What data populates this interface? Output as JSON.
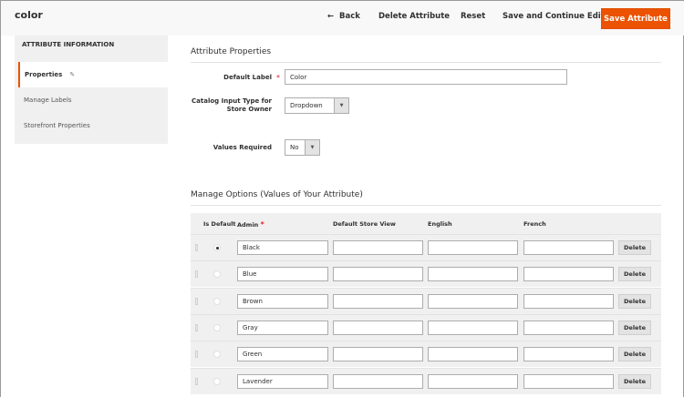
{
  "header": {
    "title": "color",
    "back": "Back",
    "delete": "Delete Attribute",
    "reset": "Reset",
    "save_continue": "Save and Continue Edit",
    "save": "Save Attribute"
  },
  "sidebar": {
    "heading": "ATTRIBUTE INFORMATION",
    "items": [
      {
        "label": "Properties"
      },
      {
        "label": "Manage Labels"
      },
      {
        "label": "Storefront Properties"
      }
    ]
  },
  "properties": {
    "title": "Attribute Properties",
    "default_label": "Default Label",
    "default_label_value": "Color",
    "input_type_label": "Catalog Input Type for Store Owner",
    "input_type_value": "Dropdown",
    "values_required_label": "Values Required",
    "values_required_value": "No"
  },
  "options": {
    "title": "Manage Options (Values of Your Attribute)",
    "columns": [
      "Is Default",
      "Admin",
      "Default Store View",
      "English",
      "French"
    ],
    "delete_label": "Delete",
    "rows": [
      {
        "admin": "Black",
        "default": true
      },
      {
        "admin": "Blue",
        "default": false
      },
      {
        "admin": "Brown",
        "default": false
      },
      {
        "admin": "Gray",
        "default": false
      },
      {
        "admin": "Green",
        "default": false
      },
      {
        "admin": "Lavender",
        "default": false
      }
    ]
  },
  "colors": {
    "accent": "#eb5202"
  }
}
